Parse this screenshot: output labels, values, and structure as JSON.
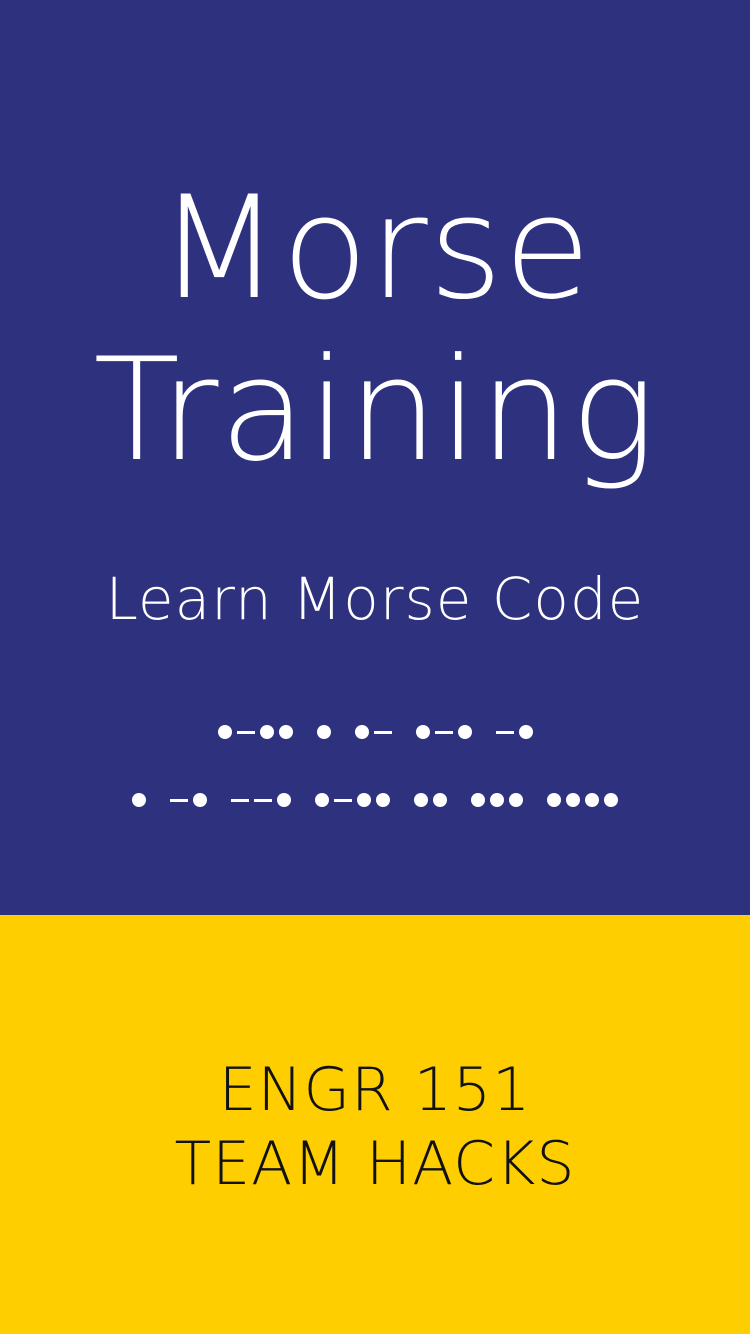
{
  "colors": {
    "top_background": "#2e317e",
    "bottom_background": "#fece00",
    "top_text": "#ffffff",
    "bottom_text": "#111111"
  },
  "splash": {
    "title_lines": [
      "Morse",
      "Training"
    ],
    "subtitle": "Learn Morse Code",
    "morse_lines": [
      ".-.. . .- .-. -.",
      ". -. --. .-.. .. ... ...."
    ]
  },
  "footer": {
    "lines": [
      "ENGR 151",
      "TEAM HACKS"
    ]
  }
}
